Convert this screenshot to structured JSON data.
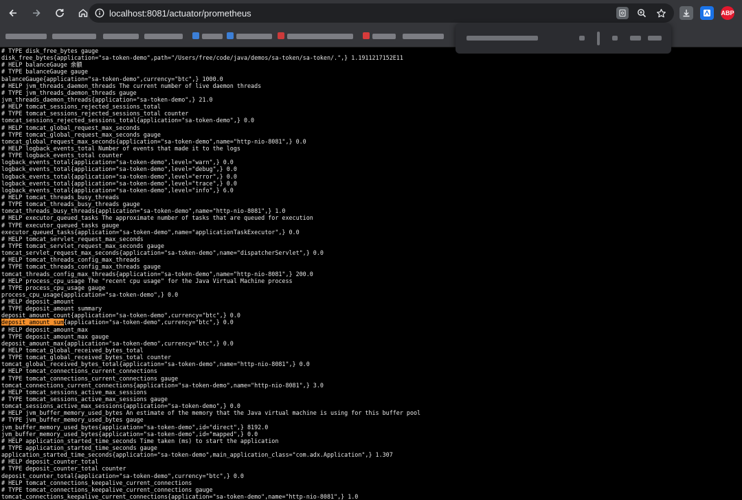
{
  "browser": {
    "url": "localhost:8081/actuator/prometheus",
    "icons": {
      "back": "arrow-left-icon",
      "forward": "arrow-right-icon",
      "reload": "reload-icon",
      "home": "home-icon",
      "site_info": "site-info-icon",
      "install": "install-icon",
      "zoom": "zoom-icon",
      "bookmark": "star-icon"
    },
    "extensions": [
      {
        "name": "download-extension-icon",
        "color": "#e8eaed"
      },
      {
        "name": "translate-extension-icon",
        "color": "#1a73e8"
      },
      {
        "name": "adblock-extension-icon",
        "label": "ABP",
        "color": "#e3192e"
      }
    ]
  },
  "search_highlight": "deposit_amount_sum",
  "lines": [
    "# TYPE disk_free_bytes gauge",
    "disk_free_bytes{application=\"sa-token-demo\",path=\"/Users/free/code/java/demos/sa-token/sa-token/.\",} 1.1911217152E11",
    "# HELP balanceGauge 余额",
    "# TYPE balanceGauge gauge",
    "balanceGauge{application=\"sa-token-demo\",currency=\"btc\",} 1000.0",
    "# HELP jvm_threads_daemon_threads The current number of live daemon threads",
    "# TYPE jvm_threads_daemon_threads gauge",
    "jvm_threads_daemon_threads{application=\"sa-token-demo\",} 21.0",
    "# HELP tomcat_sessions_rejected_sessions_total",
    "# TYPE tomcat_sessions_rejected_sessions_total counter",
    "tomcat_sessions_rejected_sessions_total{application=\"sa-token-demo\",} 0.0",
    "# HELP tomcat_global_request_max_seconds",
    "# TYPE tomcat_global_request_max_seconds gauge",
    "tomcat_global_request_max_seconds{application=\"sa-token-demo\",name=\"http-nio-8081\",} 0.0",
    "# HELP logback_events_total Number of events that made it to the logs",
    "# TYPE logback_events_total counter",
    "logback_events_total{application=\"sa-token-demo\",level=\"warn\",} 0.0",
    "logback_events_total{application=\"sa-token-demo\",level=\"debug\",} 0.0",
    "logback_events_total{application=\"sa-token-demo\",level=\"error\",} 0.0",
    "logback_events_total{application=\"sa-token-demo\",level=\"trace\",} 0.0",
    "logback_events_total{application=\"sa-token-demo\",level=\"info\",} 6.0",
    "# HELP tomcat_threads_busy_threads",
    "# TYPE tomcat_threads_busy_threads gauge",
    "tomcat_threads_busy_threads{application=\"sa-token-demo\",name=\"http-nio-8081\",} 1.0",
    "# HELP executor_queued_tasks The approximate number of tasks that are queued for execution",
    "# TYPE executor_queued_tasks gauge",
    "executor_queued_tasks{application=\"sa-token-demo\",name=\"applicationTaskExecutor\",} 0.0",
    "# HELP tomcat_servlet_request_max_seconds",
    "# TYPE tomcat_servlet_request_max_seconds gauge",
    "tomcat_servlet_request_max_seconds{application=\"sa-token-demo\",name=\"dispatcherServlet\",} 0.0",
    "# HELP tomcat_threads_config_max_threads",
    "# TYPE tomcat_threads_config_max_threads gauge",
    "tomcat_threads_config_max_threads{application=\"sa-token-demo\",name=\"http-nio-8081\",} 200.0",
    "# HELP process_cpu_usage The \"recent cpu usage\" for the Java Virtual Machine process",
    "# TYPE process_cpu_usage gauge",
    "process_cpu_usage{application=\"sa-token-demo\",} 0.0",
    "# HELP deposit_amount",
    "# TYPE deposit_amount summary",
    "deposit_amount_count{application=\"sa-token-demo\",currency=\"btc\",} 0.0",
    "deposit_amount_sum{application=\"sa-token-demo\",currency=\"btc\",} 0.0",
    "# HELP deposit_amount_max",
    "# TYPE deposit_amount_max gauge",
    "deposit_amount_max{application=\"sa-token-demo\",currency=\"btc\",} 0.0",
    "# HELP tomcat_global_received_bytes_total",
    "# TYPE tomcat_global_received_bytes_total counter",
    "tomcat_global_received_bytes_total{application=\"sa-token-demo\",name=\"http-nio-8081\",} 0.0",
    "# HELP tomcat_connections_current_connections",
    "# TYPE tomcat_connections_current_connections gauge",
    "tomcat_connections_current_connections{application=\"sa-token-demo\",name=\"http-nio-8081\",} 3.0",
    "# HELP tomcat_sessions_active_max_sessions",
    "# TYPE tomcat_sessions_active_max_sessions gauge",
    "tomcat_sessions_active_max_sessions{application=\"sa-token-demo\",} 0.0",
    "# HELP jvm_buffer_memory_used_bytes An estimate of the memory that the Java virtual machine is using for this buffer pool",
    "# TYPE jvm_buffer_memory_used_bytes gauge",
    "jvm_buffer_memory_used_bytes{application=\"sa-token-demo\",id=\"direct\",} 8192.0",
    "jvm_buffer_memory_used_bytes{application=\"sa-token-demo\",id=\"mapped\",} 0.0",
    "# HELP application_started_time_seconds Time taken (ms) to start the application",
    "# TYPE application_started_time_seconds gauge",
    "application_started_time_seconds{application=\"sa-token-demo\",main_application_class=\"com.adx.Application\",} 1.307",
    "# HELP deposit_counter_total",
    "# TYPE deposit_counter_total counter",
    "deposit_counter_total{application=\"sa-token-demo\",currency=\"btc\",} 0.0",
    "# HELP tomcat_connections_keepalive_current_connections",
    "# TYPE tomcat_connections_keepalive_current_connections gauge",
    "tomcat_connections_keepalive_current_connections{application=\"sa-token-demo\",name=\"http-nio-8081\",} 1.0"
  ]
}
